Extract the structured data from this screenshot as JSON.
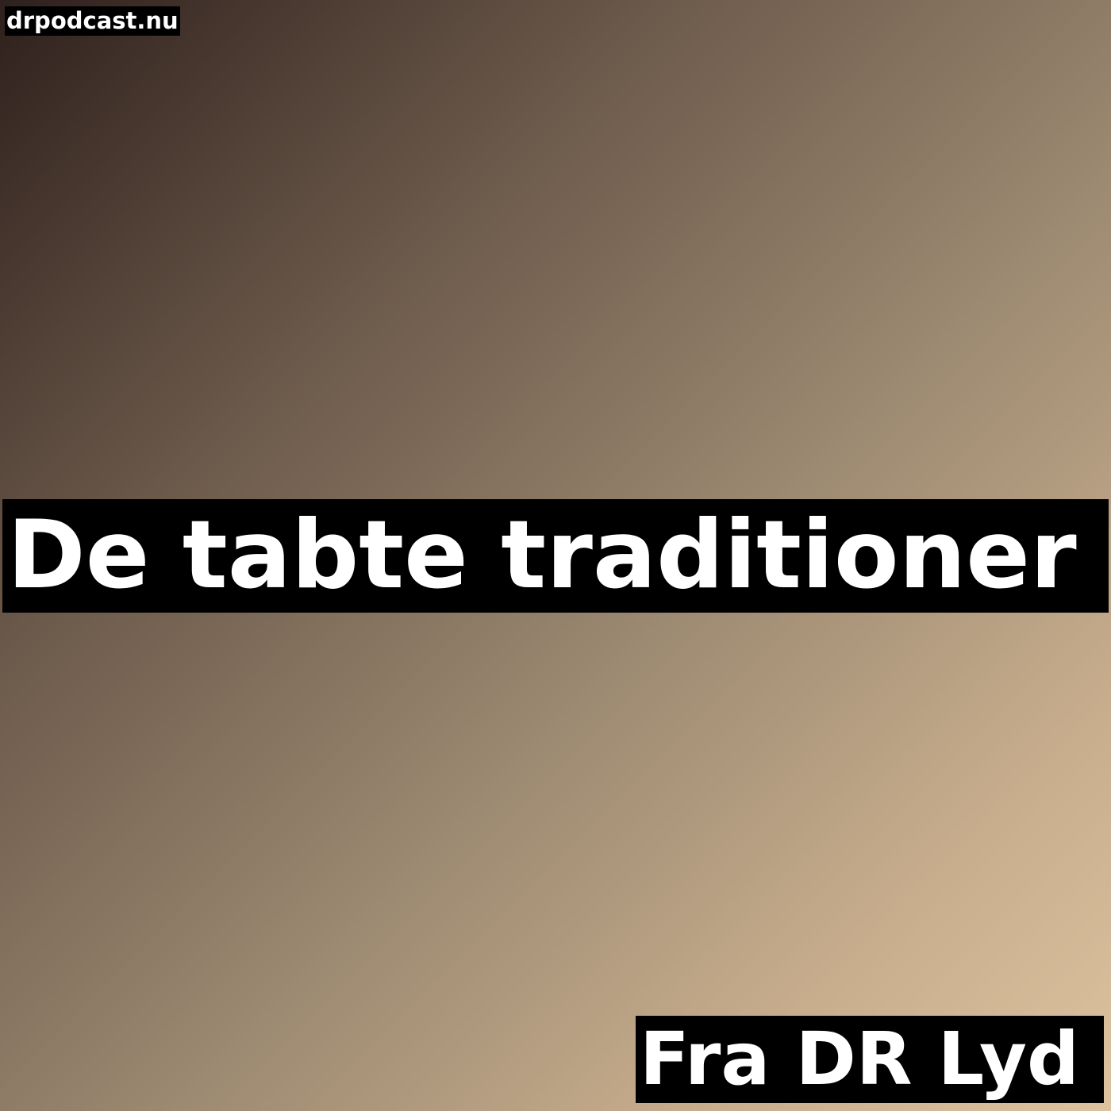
{
  "site": {
    "label": "drpodcast.nu"
  },
  "podcast": {
    "title": "De tabte traditioner",
    "source": "Fra DR Lyd"
  },
  "colors": {
    "gradient_dark": "#2e201c",
    "gradient_light": "#dcc29e",
    "banner_background": "#000000",
    "text": "#ffffff"
  }
}
